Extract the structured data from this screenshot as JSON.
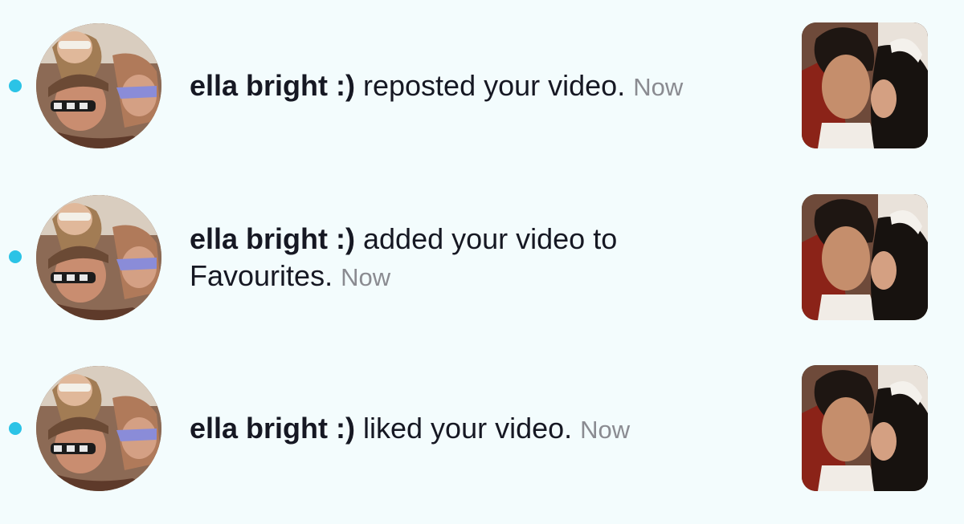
{
  "notifications": [
    {
      "user": "ella bright :)",
      "action": " reposted your video. ",
      "time": "Now",
      "unread": true,
      "avatar_icon": "profile-photo",
      "thumbnail_icon": "video-thumbnail"
    },
    {
      "user": "ella bright :)",
      "action": " added your video to Favourites. ",
      "time": "Now",
      "unread": true,
      "avatar_icon": "profile-photo",
      "thumbnail_icon": "video-thumbnail"
    },
    {
      "user": "ella bright :)",
      "action": " liked your video. ",
      "time": "Now",
      "unread": true,
      "avatar_icon": "profile-photo",
      "thumbnail_icon": "video-thumbnail"
    }
  ],
  "colors": {
    "background": "#f3fcfd",
    "unread_dot": "#2bc3e6",
    "text_primary": "#161823",
    "text_secondary": "#8a8b91"
  }
}
